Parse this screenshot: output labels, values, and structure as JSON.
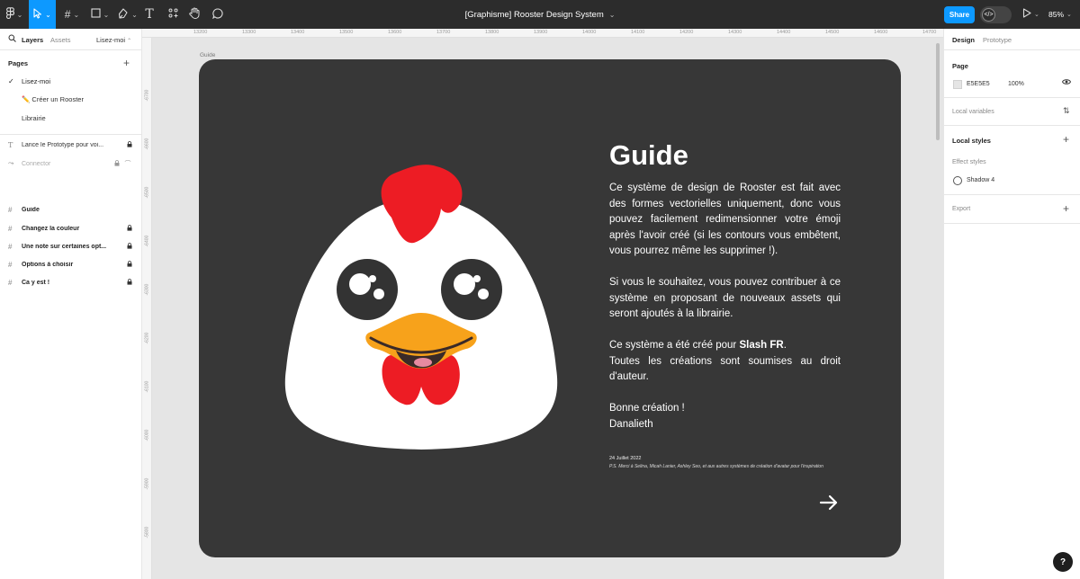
{
  "toolbar": {
    "file_title": "[Graphisme] Rooster Design System",
    "share_label": "Share",
    "zoom": "85%"
  },
  "left_panel": {
    "tab_layers": "Layers",
    "tab_assets": "Assets",
    "current_page": "Lisez-moi",
    "pages_heading": "Pages",
    "pages": [
      {
        "label": "Lisez-moi"
      },
      {
        "label": "✏️ Créer un Rooster"
      },
      {
        "label": "Librairie"
      }
    ],
    "layers": [
      {
        "label": "Lance le Prototype pour voi..."
      },
      {
        "label": "Connector"
      },
      {
        "label": "Guide"
      },
      {
        "label": "Changez la couleur"
      },
      {
        "label": "Une note sur certaines opt..."
      },
      {
        "label": "Options à choisir"
      },
      {
        "label": "Ca y est !"
      }
    ]
  },
  "ruler": {
    "top": [
      "13200",
      "13300",
      "13400",
      "13500",
      "13600",
      "13700",
      "13800",
      "13900",
      "14000",
      "14100",
      "14200",
      "14300",
      "14400",
      "14500",
      "14600",
      "14700"
    ],
    "left": [
      "-6700",
      "-6600",
      "-6500",
      "-6400",
      "-6300",
      "-6200",
      "-6100",
      "-6000",
      "-5900",
      "-5800"
    ]
  },
  "canvas": {
    "frame_label": "Guide",
    "title": "Guide",
    "para1": "Ce système de design de Rooster est fait avec des formes vectorielles uniquement, donc vous pouvez facilement redimensionner votre émoji après l'avoir créé (si les contours vous embêtent, vous pourrez même les supprimer !).",
    "para2": "Si vous le souhaitez, vous pouvez contribuer à ce système en proposant de nouveaux assets qui seront ajoutés à la librairie.",
    "para3_prefix": "Ce système a été créé pour ",
    "para3_bold": "Slash FR",
    "para3_suffix": ".",
    "para4": "Toutes les créations sont soumises au droit d'auteur.",
    "para5_line1": "Bonne création !",
    "para5_line2": "Danalieth",
    "date": "24 Juillet 2022",
    "ps": "P.S. Merci à Selina, Micah Lanier, Ashley Seo, et aux autres systèmes de création d'avatar pour l'inspiration"
  },
  "right_panel": {
    "tab_design": "Design",
    "tab_prototype": "Prototype",
    "page_heading": "Page",
    "page_color": "E5E5E5",
    "page_opacity": "100%",
    "local_variables": "Local variables",
    "local_styles": "Local styles",
    "effect_styles": "Effect styles",
    "shadow_style": "Shadow 4",
    "export": "Export"
  },
  "colors": {
    "accent": "#0d99ff",
    "frame": "#373737",
    "canvas": "#e5e5e5",
    "comb": "#ed1c24",
    "beak": "#f7a21b"
  }
}
